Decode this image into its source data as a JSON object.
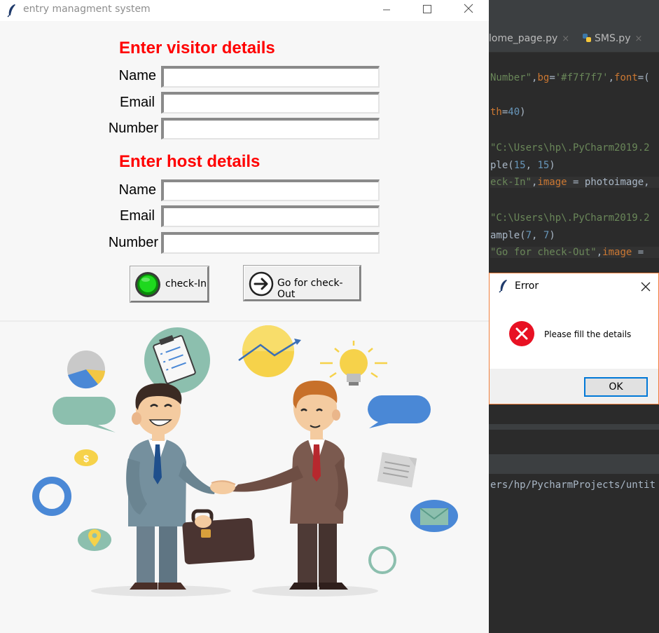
{
  "main_window": {
    "title": "entry managment system",
    "visitor_heading": "Enter visitor details",
    "host_heading": "Enter host details",
    "visitor_fields": [
      {
        "label": "Name",
        "value": ""
      },
      {
        "label": "Email",
        "value": ""
      },
      {
        "label": "Number",
        "value": ""
      }
    ],
    "host_fields": [
      {
        "label": "Name",
        "value": ""
      },
      {
        "label": "Email",
        "value": ""
      },
      {
        "label": "Number",
        "value": ""
      }
    ],
    "checkin_label": "check-In",
    "checkout_label": "Go for check-Out",
    "icons": [
      "feather-icon",
      "minimize-icon",
      "maximize-icon",
      "close-icon",
      "green-circle-icon",
      "arrow-right-circle-icon"
    ]
  },
  "ide": {
    "tabs": [
      {
        "label": "lome_page.py",
        "close": "×"
      },
      {
        "label": "SMS.py",
        "close": "×"
      }
    ],
    "code_lines": [
      "Number\",bg='#f7f7f7',font=(",
      "th=40)",
      "\"C:\\Users\\hp\\.PyCharm2019.2",
      "ple(15, 15)",
      "eck-In\",image = photoimage,",
      "\"C:\\Users\\hp\\.PyCharm2019.2",
      "ample(7, 7)",
      "\"Go for check-Out\",image =",
      "ers/hp/PycharmProjects/untit"
    ]
  },
  "error_dialog": {
    "title": "Error",
    "message": "Please fill the details",
    "ok_label": "OK",
    "icons": [
      "feather-icon",
      "error-icon",
      "close-icon"
    ]
  },
  "colors": {
    "heading": "#ff0000",
    "window_bg": "#f7f7f7",
    "ide_bg": "#2b2b2b",
    "dialog_border": "#f07d3a",
    "ok_focus": "#0078d7",
    "error_red": "#e81123"
  }
}
